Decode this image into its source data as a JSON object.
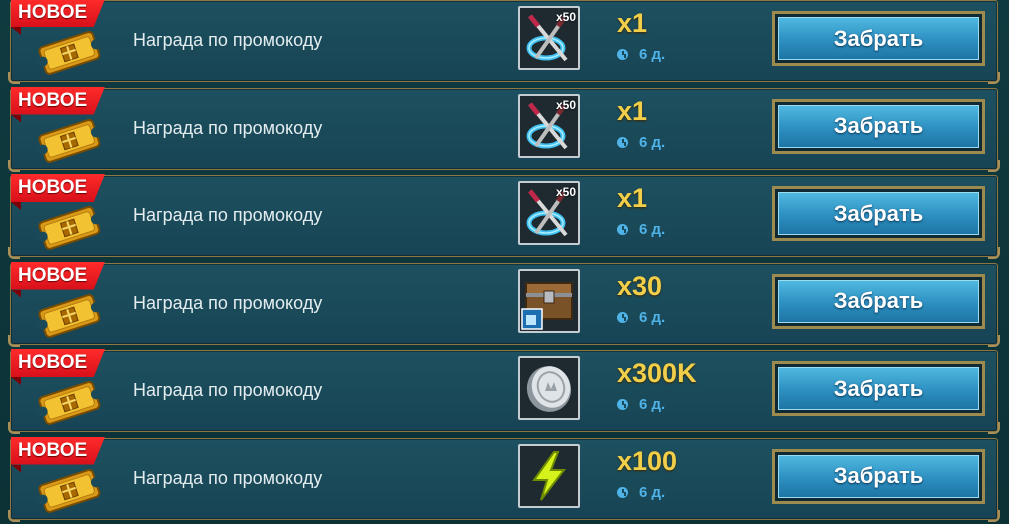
{
  "rows": [
    {
      "badge": "НОВОЕ",
      "label": "Награда по промокоду",
      "reward_icon": "swords-portal-icon",
      "reward_badge": "x50",
      "quantity": "x1",
      "timer": "6 д.",
      "button": "Забрать"
    },
    {
      "badge": "НОВОЕ",
      "label": "Награда по промокоду",
      "reward_icon": "swords-portal-icon",
      "reward_badge": "x50",
      "quantity": "x1",
      "timer": "6 д.",
      "button": "Забрать"
    },
    {
      "badge": "НОВОЕ",
      "label": "Награда по промокоду",
      "reward_icon": "swords-portal-icon",
      "reward_badge": "x50",
      "quantity": "x1",
      "timer": "6 д.",
      "button": "Забрать"
    },
    {
      "badge": "НОВОЕ",
      "label": "Награда по промокоду",
      "reward_icon": "chest-icon",
      "reward_badge": "",
      "quantity": "x30",
      "timer": "6 д.",
      "button": "Забрать"
    },
    {
      "badge": "НОВОЕ",
      "label": "Награда по промокоду",
      "reward_icon": "silver-coin-icon",
      "reward_badge": "",
      "quantity": "x300K",
      "timer": "6 д.",
      "button": "Забрать"
    },
    {
      "badge": "НОВОЕ",
      "label": "Награда по промокоду",
      "reward_icon": "energy-bolt-icon",
      "reward_badge": "",
      "quantity": "x100",
      "timer": "6 д.",
      "button": "Забрать"
    }
  ],
  "colors": {
    "quantity": "#f2cf4a",
    "timer": "#4fb3e8",
    "badge": "#e01520",
    "button": "#2d8fc0"
  }
}
